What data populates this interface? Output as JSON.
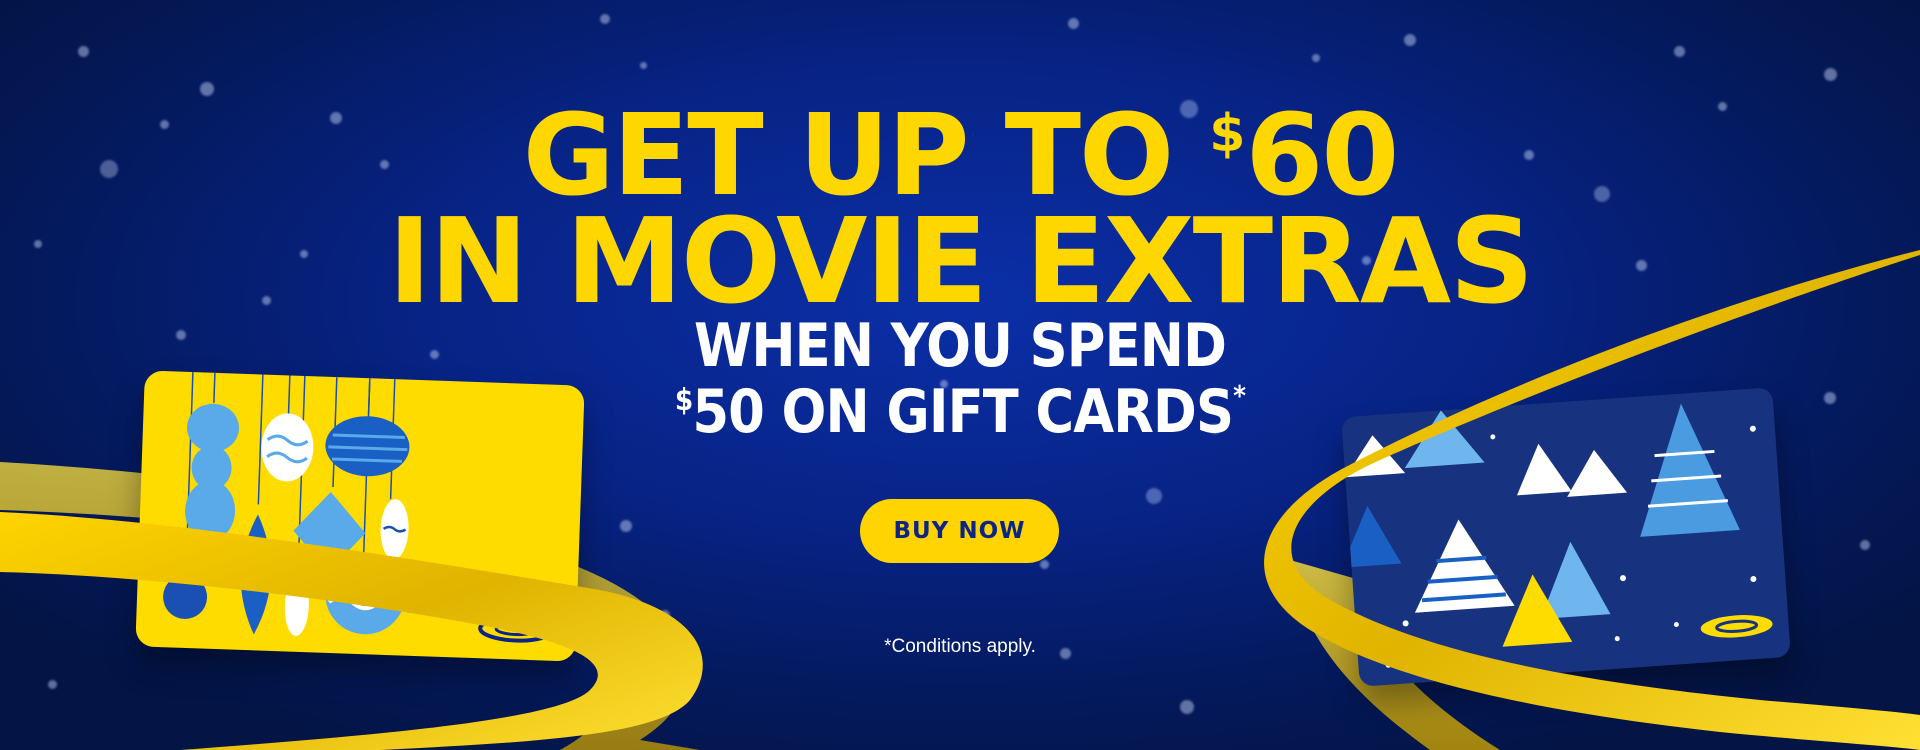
{
  "banner": {
    "headline_line1_prefix": "GET UP TO ",
    "headline_currency": "$",
    "headline_amount": "60",
    "headline_line2": "IN MOVIE EXTRAS",
    "subline1": "WHEN YOU SPEND",
    "subline2_currency": "$",
    "subline2_text": "50 ON GIFT CARDS",
    "subline2_asterisk": "*",
    "cta_label": "BUY NOW",
    "conditions": "*Conditions apply."
  },
  "colors": {
    "background": "#072385",
    "headline": "#ffd700",
    "cta_background": "#ffd400",
    "cta_text": "#0a2585",
    "ribbon": "#f5c800"
  },
  "icons": {
    "left_card_design": "ornaments",
    "right_card_design": "christmas-trees",
    "card_logo": "cineplex-logo-icon"
  }
}
